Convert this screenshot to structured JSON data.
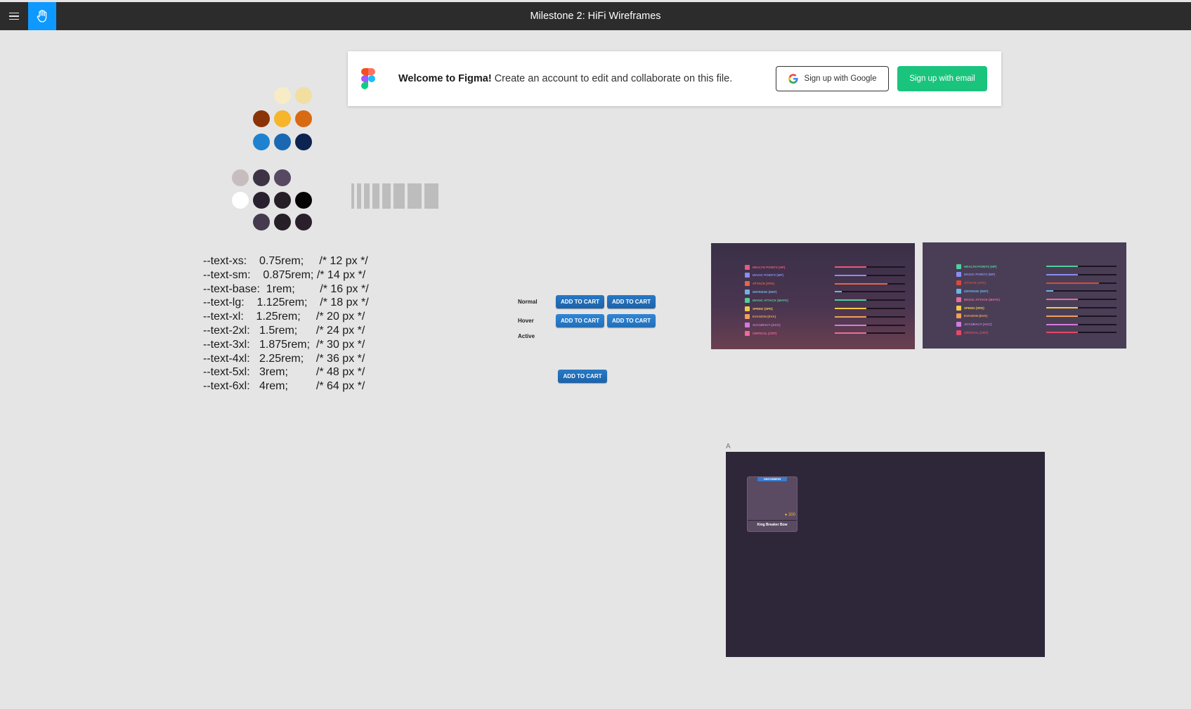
{
  "header": {
    "file_title": "Milestone 2: HiFi Wireframes",
    "menu_icon": "hamburger-menu-icon",
    "hand_tool_icon": "hand-tool-icon",
    "hand_tool_color": "#0d99ff"
  },
  "banner": {
    "welcome_bold": "Welcome to Figma!",
    "welcome_rest": " Create an account to edit and collaborate on this file.",
    "google_label": "Sign up with Google",
    "email_label": "Sign up with email",
    "email_color": "#1bc47d"
  },
  "palette": {
    "warm": [
      "#f7ecc6",
      "#f1dfa1",
      "#8b3308",
      "#f6b52a",
      "#d76a13",
      "#1f82d0",
      "#1a68b2",
      "#0d2450"
    ],
    "neutral": [
      "#c7bdbf",
      "#3e3345",
      "#574962",
      "#ffffff",
      "#2a2130",
      "#261f27",
      "#050405",
      "#463a4e",
      "#261f27",
      "#2a1f2b"
    ]
  },
  "type_scale": [
    "--text-xs:    0.75rem;     /* 12 px */",
    "--text-sm:    0.875rem; /* 14 px */",
    "--text-base:  1rem;        /* 16 px */",
    "--text-lg:    1.125rem;    /* 18 px */",
    "--text-xl:    1.25rem;     /* 20 px */",
    "--text-2xl:   1.5rem;      /* 24 px */",
    "--text-3xl:   1.875rem;  /* 30 px */",
    "--text-4xl:   2.25rem;    /* 36 px */",
    "--text-5xl:   3rem;         /* 48 px */",
    "--text-6xl:   4rem;         /* 64 px */"
  ],
  "button_states": {
    "normal_label": "Normal",
    "hover_label": "Hover",
    "active_label": "Active",
    "button_text": "ADD TO CART"
  },
  "stats": [
    {
      "label": "HEALTH POINTS (HP)",
      "color": "#e75a7c",
      "value": 0.45
    },
    {
      "label": "MAGIC POINTS (MP)",
      "color": "#8a8ef0",
      "value": 0.45
    },
    {
      "label": "ATTACK (ATK)",
      "color": "#e5664a",
      "value": 0.75
    },
    {
      "label": "DEFENSE (DEF)",
      "color": "#6fb3e8",
      "value": 0.1
    },
    {
      "label": "MAGIC ATTACK (MATK)",
      "color": "#4fcf9a",
      "value": 0.45
    },
    {
      "label": "SPEED (SPD)",
      "color": "#f2c94c",
      "value": 0.45
    },
    {
      "label": "EVASION (EVA)",
      "color": "#f0a05a",
      "value": 0.45
    },
    {
      "label": "ACCURACY (ACC)",
      "color": "#d07be0",
      "value": 0.45
    },
    {
      "label": "CRITICAL (CRT)",
      "color": "#f06a9a",
      "value": 0.45
    }
  ],
  "stats_alt": [
    {
      "label": "HEALTH POINTS (HP)",
      "color": "#4fcf9a",
      "value": 0.45
    },
    {
      "label": "MAGIC POINTS (MP)",
      "color": "#8a8ef0",
      "value": 0.45
    },
    {
      "label": "ATTACK (ATK)",
      "color": "#d84a3a",
      "value": 0.75
    },
    {
      "label": "DEFENSE (DEF)",
      "color": "#6fb3e8",
      "value": 0.1
    },
    {
      "label": "MAGIC ATTACK (MATK)",
      "color": "#e56b9f",
      "value": 0.45
    },
    {
      "label": "SPEED (SPD)",
      "color": "#f2c94c",
      "value": 0.45
    },
    {
      "label": "EVASION (EVA)",
      "color": "#f0a05a",
      "value": 0.45
    },
    {
      "label": "ACCURACY (ACC)",
      "color": "#d07be0",
      "value": 0.45
    },
    {
      "label": "CRITICAL (CRT)",
      "color": "#e5486a",
      "value": 0.45
    }
  ],
  "frame_a": {
    "label": "A",
    "badge": "UNCOMMON",
    "price": "300",
    "item_name": "King Breaker Bow"
  }
}
